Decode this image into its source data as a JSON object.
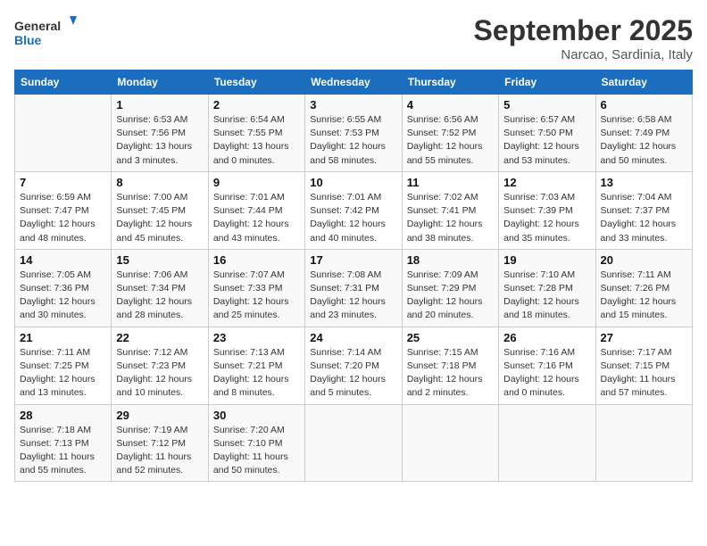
{
  "header": {
    "logo_general": "General",
    "logo_blue": "Blue",
    "month_title": "September 2025",
    "subtitle": "Narcao, Sardinia, Italy"
  },
  "weekdays": [
    "Sunday",
    "Monday",
    "Tuesday",
    "Wednesday",
    "Thursday",
    "Friday",
    "Saturday"
  ],
  "weeks": [
    [
      {
        "day": "",
        "info": ""
      },
      {
        "day": "1",
        "info": "Sunrise: 6:53 AM\nSunset: 7:56 PM\nDaylight: 13 hours\nand 3 minutes."
      },
      {
        "day": "2",
        "info": "Sunrise: 6:54 AM\nSunset: 7:55 PM\nDaylight: 13 hours\nand 0 minutes."
      },
      {
        "day": "3",
        "info": "Sunrise: 6:55 AM\nSunset: 7:53 PM\nDaylight: 12 hours\nand 58 minutes."
      },
      {
        "day": "4",
        "info": "Sunrise: 6:56 AM\nSunset: 7:52 PM\nDaylight: 12 hours\nand 55 minutes."
      },
      {
        "day": "5",
        "info": "Sunrise: 6:57 AM\nSunset: 7:50 PM\nDaylight: 12 hours\nand 53 minutes."
      },
      {
        "day": "6",
        "info": "Sunrise: 6:58 AM\nSunset: 7:49 PM\nDaylight: 12 hours\nand 50 minutes."
      }
    ],
    [
      {
        "day": "7",
        "info": "Sunrise: 6:59 AM\nSunset: 7:47 PM\nDaylight: 12 hours\nand 48 minutes."
      },
      {
        "day": "8",
        "info": "Sunrise: 7:00 AM\nSunset: 7:45 PM\nDaylight: 12 hours\nand 45 minutes."
      },
      {
        "day": "9",
        "info": "Sunrise: 7:01 AM\nSunset: 7:44 PM\nDaylight: 12 hours\nand 43 minutes."
      },
      {
        "day": "10",
        "info": "Sunrise: 7:01 AM\nSunset: 7:42 PM\nDaylight: 12 hours\nand 40 minutes."
      },
      {
        "day": "11",
        "info": "Sunrise: 7:02 AM\nSunset: 7:41 PM\nDaylight: 12 hours\nand 38 minutes."
      },
      {
        "day": "12",
        "info": "Sunrise: 7:03 AM\nSunset: 7:39 PM\nDaylight: 12 hours\nand 35 minutes."
      },
      {
        "day": "13",
        "info": "Sunrise: 7:04 AM\nSunset: 7:37 PM\nDaylight: 12 hours\nand 33 minutes."
      }
    ],
    [
      {
        "day": "14",
        "info": "Sunrise: 7:05 AM\nSunset: 7:36 PM\nDaylight: 12 hours\nand 30 minutes."
      },
      {
        "day": "15",
        "info": "Sunrise: 7:06 AM\nSunset: 7:34 PM\nDaylight: 12 hours\nand 28 minutes."
      },
      {
        "day": "16",
        "info": "Sunrise: 7:07 AM\nSunset: 7:33 PM\nDaylight: 12 hours\nand 25 minutes."
      },
      {
        "day": "17",
        "info": "Sunrise: 7:08 AM\nSunset: 7:31 PM\nDaylight: 12 hours\nand 23 minutes."
      },
      {
        "day": "18",
        "info": "Sunrise: 7:09 AM\nSunset: 7:29 PM\nDaylight: 12 hours\nand 20 minutes."
      },
      {
        "day": "19",
        "info": "Sunrise: 7:10 AM\nSunset: 7:28 PM\nDaylight: 12 hours\nand 18 minutes."
      },
      {
        "day": "20",
        "info": "Sunrise: 7:11 AM\nSunset: 7:26 PM\nDaylight: 12 hours\nand 15 minutes."
      }
    ],
    [
      {
        "day": "21",
        "info": "Sunrise: 7:11 AM\nSunset: 7:25 PM\nDaylight: 12 hours\nand 13 minutes."
      },
      {
        "day": "22",
        "info": "Sunrise: 7:12 AM\nSunset: 7:23 PM\nDaylight: 12 hours\nand 10 minutes."
      },
      {
        "day": "23",
        "info": "Sunrise: 7:13 AM\nSunset: 7:21 PM\nDaylight: 12 hours\nand 8 minutes."
      },
      {
        "day": "24",
        "info": "Sunrise: 7:14 AM\nSunset: 7:20 PM\nDaylight: 12 hours\nand 5 minutes."
      },
      {
        "day": "25",
        "info": "Sunrise: 7:15 AM\nSunset: 7:18 PM\nDaylight: 12 hours\nand 2 minutes."
      },
      {
        "day": "26",
        "info": "Sunrise: 7:16 AM\nSunset: 7:16 PM\nDaylight: 12 hours\nand 0 minutes."
      },
      {
        "day": "27",
        "info": "Sunrise: 7:17 AM\nSunset: 7:15 PM\nDaylight: 11 hours\nand 57 minutes."
      }
    ],
    [
      {
        "day": "28",
        "info": "Sunrise: 7:18 AM\nSunset: 7:13 PM\nDaylight: 11 hours\nand 55 minutes."
      },
      {
        "day": "29",
        "info": "Sunrise: 7:19 AM\nSunset: 7:12 PM\nDaylight: 11 hours\nand 52 minutes."
      },
      {
        "day": "30",
        "info": "Sunrise: 7:20 AM\nSunset: 7:10 PM\nDaylight: 11 hours\nand 50 minutes."
      },
      {
        "day": "",
        "info": ""
      },
      {
        "day": "",
        "info": ""
      },
      {
        "day": "",
        "info": ""
      },
      {
        "day": "",
        "info": ""
      }
    ]
  ]
}
